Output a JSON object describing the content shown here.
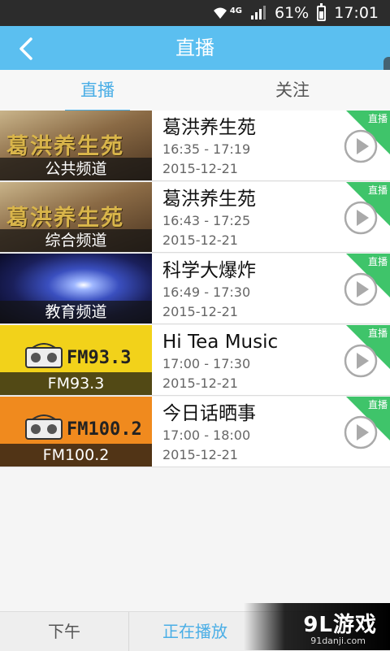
{
  "status_bar": {
    "battery": "61%",
    "time": "17:01",
    "network": "4G"
  },
  "header": {
    "title": "直播"
  },
  "tabs": [
    {
      "label": "直播",
      "active": true
    },
    {
      "label": "关注",
      "active": false
    }
  ],
  "live_badge": "直播",
  "programs": [
    {
      "channel": "公共频道",
      "logo_text": "葛洪养生苑",
      "title": "葛洪养生苑",
      "time": "16:35 - 17:19",
      "date": "2015-12-21",
      "thumb_bg": "#7a5a3a"
    },
    {
      "channel": "综合频道",
      "logo_text": "葛洪养生苑",
      "title": "葛洪养生苑",
      "time": "16:43 - 17:25",
      "date": "2015-12-21",
      "thumb_bg": "#7a5a3a"
    },
    {
      "channel": "教育频道",
      "logo_text": "",
      "title": "科学大爆炸",
      "time": "16:49 - 17:30",
      "date": "2015-12-21",
      "thumb_bg": "#1a1f5a"
    },
    {
      "channel": "FM93.3",
      "logo_text": "FM93.3",
      "title": "Hi Tea Music",
      "time": "17:00 - 17:30",
      "date": "2015-12-21",
      "thumb_bg": "#f2d21a"
    },
    {
      "channel": "FM100.2",
      "logo_text": "FM100.2",
      "title": "今日话晒事",
      "time": "17:00 - 18:00",
      "date": "2015-12-21",
      "thumb_bg": "#f08a1e"
    }
  ],
  "bottom_tabs": [
    {
      "label": "下午",
      "active": false
    },
    {
      "label": "正在播放",
      "active": true
    }
  ],
  "watermark": {
    "text": "9L游戏",
    "url": "91danji.com"
  },
  "colors": {
    "primary": "#5bbff0",
    "accent": "#4aaee6",
    "live_badge": "#3fc46a",
    "status_bar": "#2c2c2c"
  }
}
